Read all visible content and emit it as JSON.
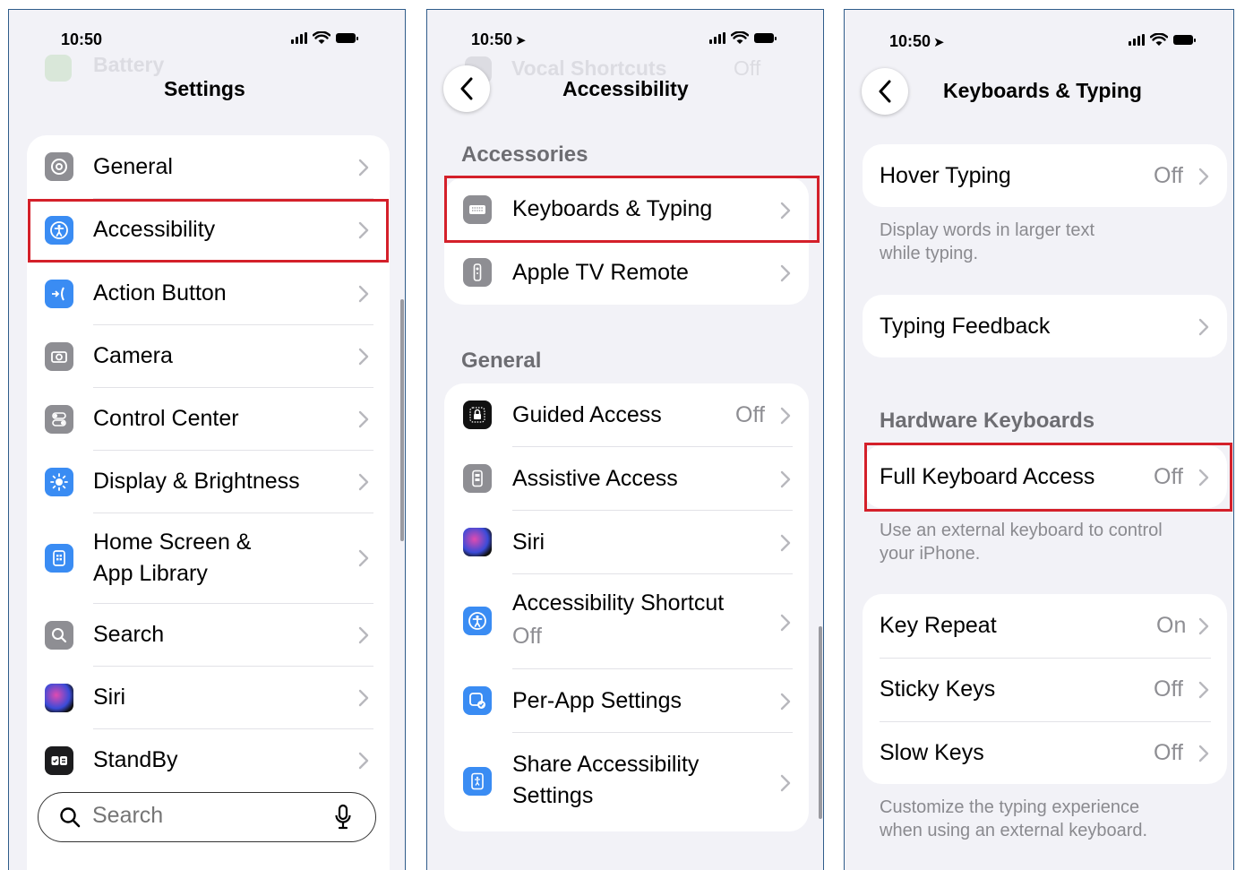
{
  "screen1": {
    "time": "10:50",
    "ghost": "Battery",
    "title": "Settings",
    "items": [
      {
        "label": "General"
      },
      {
        "label": "Accessibility"
      },
      {
        "label": "Action Button"
      },
      {
        "label": "Camera"
      },
      {
        "label": "Control Center"
      },
      {
        "label": "Display & Brightness"
      },
      {
        "label": "Home Screen &",
        "label2": "App Library"
      },
      {
        "label": "Search"
      },
      {
        "label": "Siri"
      },
      {
        "label": "StandBy"
      }
    ],
    "search_placeholder": "Search"
  },
  "screen2": {
    "time": "10:50",
    "ghost": "Vocal Shortcuts",
    "ghost_value": "Off",
    "title": "Accessibility",
    "accessories_header": "Accessories",
    "accessories": [
      {
        "label": "Keyboards & Typing"
      },
      {
        "label": "Apple TV Remote"
      }
    ],
    "general_header": "General",
    "general": [
      {
        "label": "Guided Access",
        "value": "Off"
      },
      {
        "label": "Assistive Access"
      },
      {
        "label": "Siri"
      },
      {
        "label": "Accessibility Shortcut",
        "sub": "Off"
      },
      {
        "label": "Per-App Settings"
      },
      {
        "label": "Share Accessibility",
        "label2": "Settings"
      }
    ]
  },
  "screen3": {
    "time": "10:50",
    "title": "Keyboards & Typing",
    "hover_typing": {
      "label": "Hover Typing",
      "value": "Off"
    },
    "hover_note_1": "Display words in larger text",
    "hover_note_2": "while typing.",
    "typing_feedback": {
      "label": "Typing Feedback"
    },
    "hardware_header": "Hardware Keyboards",
    "full_keyboard": {
      "label": "Full Keyboard Access",
      "value": "Off"
    },
    "full_note_1": "Use an external keyboard to control",
    "full_note_2": "your iPhone.",
    "key_rows": [
      {
        "label": "Key Repeat",
        "value": "On"
      },
      {
        "label": "Sticky Keys",
        "value": "Off"
      },
      {
        "label": "Slow Keys",
        "value": "Off"
      }
    ],
    "keys_note_1": "Customize the typing experience",
    "keys_note_2": "when using an external keyboard."
  },
  "colors": {
    "highlight": "#d4202a",
    "blue_icon": "#3a8cf3",
    "gray_icon": "#8e8e93",
    "background": "#f2f2f7"
  }
}
